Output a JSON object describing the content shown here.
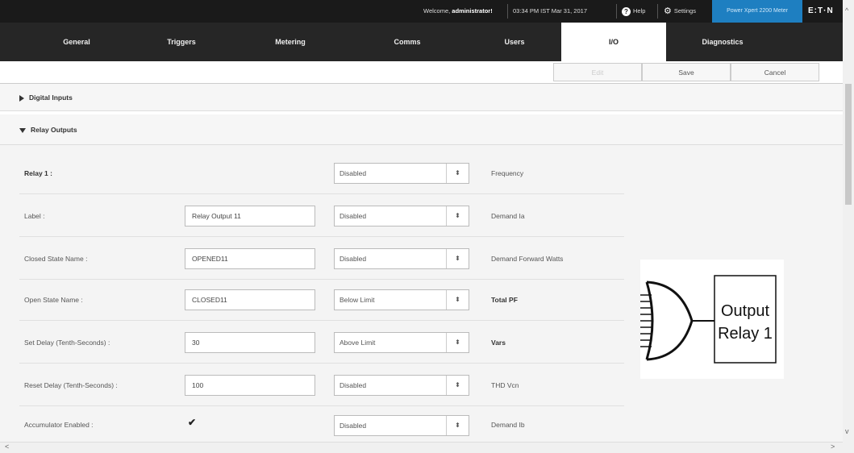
{
  "topbar": {
    "welcome_prefix": "Welcome, ",
    "username": "administrator!",
    "datetime": "03:34 PM IST Mar 31, 2017",
    "help_label": "Help",
    "settings_label": "Settings",
    "device_label": "Power Xpert 2200 Meter",
    "logo": "E:T·N"
  },
  "nav": {
    "tabs": [
      "General",
      "Triggers",
      "Metering",
      "Comms",
      "Users",
      "I/O",
      "Diagnostics"
    ],
    "active": "I/O"
  },
  "toolbar": {
    "edit_label": "Edit",
    "save_label": "Save",
    "cancel_label": "Cancel"
  },
  "sections": {
    "digital_inputs": "Digital Inputs",
    "relay_outputs": "Relay Outputs"
  },
  "relay": {
    "title": "Relay 1 :",
    "label_label": "Label :",
    "label_value": "Relay Output 11",
    "closed_label": "Closed State Name :",
    "closed_value": "OPENED11",
    "open_label": "Open State Name :",
    "open_value": "CLOSED11",
    "delay_label": "Set Delay (Tenth-Seconds) :",
    "delay_value": "30",
    "reset_label": "Reset Delay (Tenth-Seconds) :",
    "reset_value": "100",
    "accumulator_label": "Accumulator Enabled :",
    "accumulator_checked": true
  },
  "conditions": [
    {
      "mode": "Disabled",
      "param": "Frequency",
      "bold": false
    },
    {
      "mode": "Disabled",
      "param": "Demand Ia",
      "bold": false
    },
    {
      "mode": "Disabled",
      "param": "Demand Forward Watts",
      "bold": false
    },
    {
      "mode": "Below Limit",
      "param": "Total PF",
      "bold": true
    },
    {
      "mode": "Above Limit",
      "param": "Vars",
      "bold": true
    },
    {
      "mode": "Disabled",
      "param": "THD Vcn",
      "bold": false
    },
    {
      "mode": "Disabled",
      "param": "Demand Ib",
      "bold": false
    }
  ],
  "diagram": {
    "line1": "Output",
    "line2": "Relay 1"
  },
  "icons": {
    "help": "help-icon",
    "settings": "gear-icon",
    "select_arrow": "updown-arrow-icon",
    "check": "checkmark-icon"
  }
}
